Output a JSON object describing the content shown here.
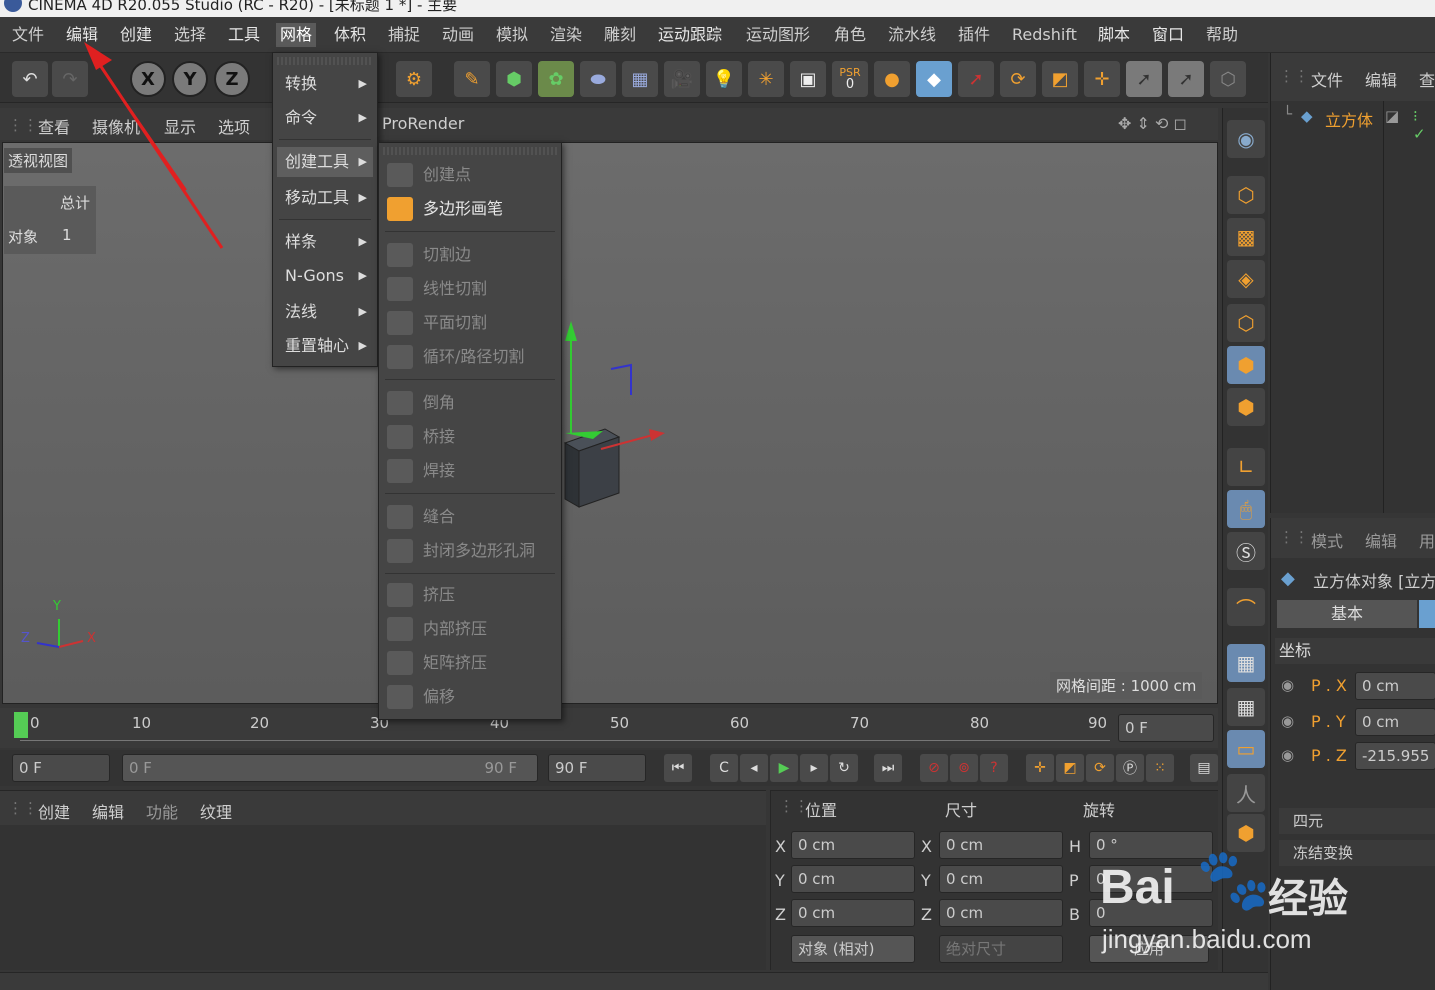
{
  "window": {
    "title": "CINEMA 4D R20.055 Studio (RC - R20) - [未标题 1 *] - 主要"
  },
  "menubar": {
    "items": [
      "文件",
      "编辑",
      "创建",
      "选择",
      "工具",
      "网格",
      "体积",
      "捕捉",
      "动画",
      "模拟",
      "渲染",
      "雕刻",
      "运动跟踪",
      "运动图形",
      "角色",
      "流水线",
      "插件",
      "Redshift",
      "脚本",
      "窗口",
      "帮助"
    ]
  },
  "viewport": {
    "menu": [
      "查看",
      "摄像机",
      "显示",
      "选项"
    ],
    "renderer": "ProRender",
    "view_name": "透视视图",
    "stats_header": "总计",
    "stats_label": "对象",
    "stats_value": "1",
    "grid_spacing": "网格间距 : 1000 cm",
    "axis_y": "Y",
    "axis_z": "Z",
    "axis_x": "X"
  },
  "mesh_menu": {
    "items": [
      {
        "label": "转换"
      },
      {
        "label": "命令"
      },
      {
        "label": "创建工具"
      },
      {
        "label": "移动工具"
      },
      {
        "label": "样条"
      },
      {
        "label": "N-Gons"
      },
      {
        "label": "法线"
      },
      {
        "label": "重置轴心"
      }
    ]
  },
  "create_tools_menu": {
    "items": [
      {
        "label": "创建点",
        "enabled": false
      },
      {
        "label": "多边形画笔",
        "enabled": true
      },
      {
        "label": "切割边",
        "enabled": false
      },
      {
        "label": "线性切割",
        "enabled": false
      },
      {
        "label": "平面切割",
        "enabled": false
      },
      {
        "label": "循环/路径切割",
        "enabled": false
      },
      {
        "label": "倒角",
        "enabled": false
      },
      {
        "label": "桥接",
        "enabled": false
      },
      {
        "label": "焊接",
        "enabled": false
      },
      {
        "label": "缝合",
        "enabled": false
      },
      {
        "label": "封闭多边形孔洞",
        "enabled": false
      },
      {
        "label": "挤压",
        "enabled": false
      },
      {
        "label": "内部挤压",
        "enabled": false
      },
      {
        "label": "矩阵挤压",
        "enabled": false
      },
      {
        "label": "偏移",
        "enabled": false
      }
    ]
  },
  "toolbar": {
    "axis_x": "X",
    "axis_y": "Y",
    "axis_z": "Z",
    "psr_label": "PSR",
    "psr_value": "0"
  },
  "object_manager": {
    "menu": [
      "文件",
      "编辑",
      "查"
    ],
    "object_name": "立方体"
  },
  "attribute_manager": {
    "menu": [
      "模式",
      "编辑",
      "用"
    ],
    "object_title": "立方体对象 [立方",
    "tab_basic": "基本",
    "section_coord": "坐标",
    "px_label": "P . X",
    "px_value": "0 cm",
    "py_label": "P . Y",
    "py_value": "0 cm",
    "pz_label": "P . Z",
    "pz_value": "-215.955",
    "quaternion": "四元",
    "freeze": "冻结变换"
  },
  "timeline": {
    "ticks": [
      "0",
      "10",
      "20",
      "30",
      "40",
      "50",
      "60",
      "70",
      "80",
      "90"
    ],
    "current_frame": "0 F",
    "start_field": "0 F",
    "range_start": "0 F",
    "range_end": "90 F",
    "end_field": "90 F"
  },
  "material_panel": {
    "menu": [
      "创建",
      "编辑",
      "功能",
      "纹理"
    ]
  },
  "coord_panel": {
    "col_pos": "位置",
    "col_size": "尺寸",
    "col_rot": "旋转",
    "x_label": "X",
    "y_label": "Y",
    "z_label": "Z",
    "pos_x": "0 cm",
    "pos_y": "0 cm",
    "pos_z": "0 cm",
    "size_x": "0 cm",
    "size_y": "0 cm",
    "size_z": "0 cm",
    "h_label": "H",
    "p_label": "P",
    "b_label": "B",
    "rot_h": "0 °",
    "rot_p": "0",
    "rot_b": "0",
    "mode_select": "对象 (相对)",
    "size_select": "绝对尺寸",
    "apply_button": "应用"
  },
  "watermark": {
    "brand": "Bai",
    "suffix": "经验",
    "url": "jingyan.baidu.com"
  },
  "colors": {
    "accent": "#f0a030",
    "menu_bg": "#454545",
    "viewport": "#666666",
    "arrow": "#e02020"
  }
}
